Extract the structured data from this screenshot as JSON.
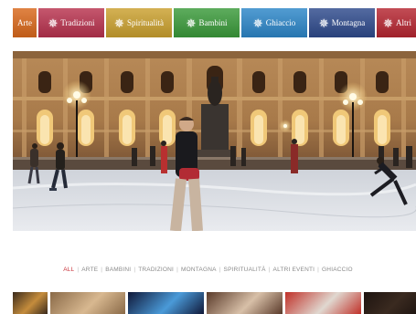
{
  "tabs": [
    {
      "label": "Arte",
      "color": "#d9681b",
      "width": 26,
      "star": false
    },
    {
      "label": "Tradizioni",
      "color": "#b8324e",
      "width": 72,
      "star": true
    },
    {
      "label": "Spiritualità",
      "color": "#caa02e",
      "width": 72,
      "star": true
    },
    {
      "label": "Bambini",
      "color": "#3a9a3a",
      "width": 72,
      "star": true
    },
    {
      "label": "Ghiaccio",
      "color": "#2c86c8",
      "width": 72,
      "star": true
    },
    {
      "label": "Montagna",
      "color": "#2e4a8c",
      "width": 72,
      "star": true
    },
    {
      "label": "Altri",
      "color": "#b52530",
      "width": 45,
      "star": true
    }
  ],
  "hero": {
    "alt": "Pista di pattinaggio sul ghiaccio davanti a un palazzo illuminato"
  },
  "filters": [
    {
      "label": "ALL",
      "active": true
    },
    {
      "label": "ARTE",
      "active": false
    },
    {
      "label": "BAMBINI",
      "active": false
    },
    {
      "label": "TRADIZIONI",
      "active": false
    },
    {
      "label": "MONTAGNA",
      "active": false
    },
    {
      "label": "SPIRITUALITÀ",
      "active": false
    },
    {
      "label": "ALTRI EVENTI",
      "active": false
    },
    {
      "label": "GHIACCIO",
      "active": false
    }
  ],
  "thumbnails": [
    {
      "name": "thumb-1",
      "width": 38,
      "colors": [
        "#3a2a1c",
        "#c48c3c"
      ]
    },
    {
      "name": "thumb-2",
      "width": 82,
      "colors": [
        "#8a6a48",
        "#d8b890"
      ]
    },
    {
      "name": "thumb-3",
      "width": 83,
      "colors": [
        "#101838",
        "#4a9ad8"
      ]
    },
    {
      "name": "thumb-4",
      "width": 83,
      "colors": [
        "#5a3a2a",
        "#d8c0a8"
      ]
    },
    {
      "name": "thumb-5",
      "width": 83,
      "colors": [
        "#c03028",
        "#e0d8d0"
      ]
    },
    {
      "name": "thumb-6",
      "width": 60,
      "colors": [
        "#1e1410",
        "#3a2a20"
      ]
    }
  ],
  "colors": {
    "accent": "#c8323a",
    "filter_text": "#8a8a8a"
  }
}
